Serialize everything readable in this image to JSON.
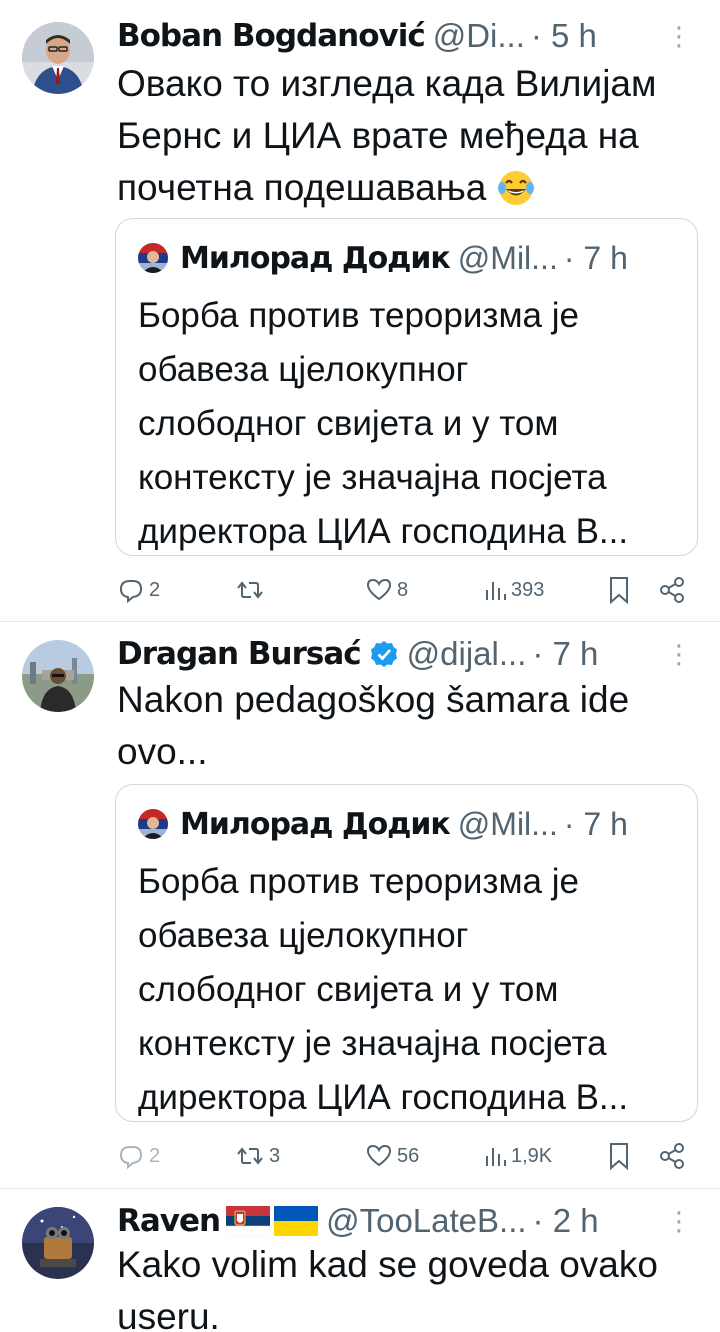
{
  "tweets": [
    {
      "name": "Boban Bogdanović",
      "handle": "@Di...",
      "time": "· 5 h",
      "text_lines": [
        "Овако то изгледа када Вилијам",
        "Бернс и ЦИА врате међеда на",
        "почетна подешавања"
      ],
      "emoji": "laughing-tears-emoji",
      "quote": {
        "name": "Милорад Додик",
        "handle": "@Mil...",
        "time": "· 7 h",
        "text_lines": [
          "Борба против тероризма је",
          "обавеза цјелокупног",
          "слободног свијета и у том",
          "контексту је значајна посјета",
          "директора ЦИА господина В..."
        ]
      },
      "actions": {
        "replies": "2",
        "reposts": "",
        "likes": "8",
        "views": "393"
      }
    },
    {
      "name": "Dragan Bursać",
      "verified": true,
      "handle": "@dijal...",
      "time": "· 7 h",
      "text_lines": [
        "Nakon pedagoškog šamara ide",
        "ovo..."
      ],
      "quote": {
        "name": "Милорад Додик",
        "handle": "@Mil...",
        "time": "· 7 h",
        "text_lines": [
          "Борба против тероризма је",
          "обавеза цјелокупног",
          "слободног свијета и у том",
          "контексту је значајна посјета",
          "директора ЦИА господина В..."
        ]
      },
      "actions": {
        "replies": "2",
        "reposts": "3",
        "likes": "56",
        "views": "1,9K"
      }
    },
    {
      "name": "Raven",
      "flags": [
        "serbia-flag",
        "ukraine-flag"
      ],
      "handle": "@TooLateB...",
      "time": "· 2 h",
      "text_lines": [
        "Kako volim kad se goveda ovako",
        "useru."
      ]
    }
  ],
  "colors": {
    "text": "#0f1419",
    "secondary": "#536471",
    "verified": "#1d9bf0",
    "border": "#cfd9de"
  }
}
